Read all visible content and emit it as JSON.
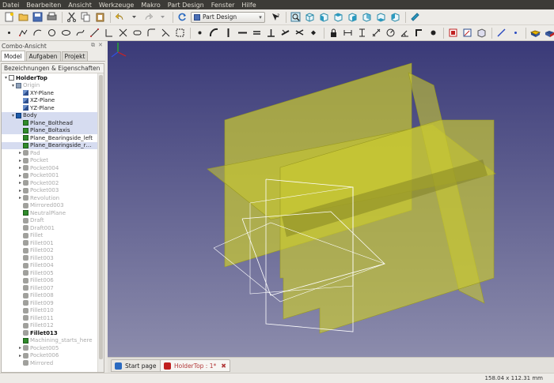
{
  "menubar": [
    "Datei",
    "Bearbeiten",
    "Ansicht",
    "Werkzeuge",
    "Makro",
    "Part Design",
    "Fenster",
    "Hilfe"
  ],
  "workbench": {
    "selected": "Part Design"
  },
  "combo": {
    "title": "Combo-Ansicht",
    "tabs": [
      "Model",
      "Aufgaben",
      "Projekt"
    ],
    "active_tab": "Model",
    "tree_header": "Bezeichnungen & Eigenschaften"
  },
  "tree": [
    {
      "label": "HolderTop",
      "depth": 0,
      "icon": "document-icon",
      "arrow": "expanded",
      "style": "bold"
    },
    {
      "label": "Origin",
      "depth": 1,
      "icon": "origin-folder-icon",
      "arrow": "expanded",
      "style": "faded"
    },
    {
      "label": "XY-Plane",
      "depth": 2,
      "icon": "plane-icon",
      "arrow": "",
      "style": ""
    },
    {
      "label": "XZ-Plane",
      "depth": 2,
      "icon": "plane-icon",
      "arrow": "",
      "style": ""
    },
    {
      "label": "YZ-Plane",
      "depth": 2,
      "icon": "plane-icon",
      "arrow": "",
      "style": ""
    },
    {
      "label": "Body",
      "depth": 1,
      "icon": "body-icon",
      "arrow": "expanded",
      "style": "selected"
    },
    {
      "label": "Plane_Bolthead",
      "depth": 2,
      "icon": "datum-plane-icon",
      "arrow": "",
      "style": "selected"
    },
    {
      "label": "Plane_Boltaxis",
      "depth": 2,
      "icon": "datum-plane-icon",
      "arrow": "",
      "style": "selected"
    },
    {
      "label": "Plane_Bearingside_left",
      "depth": 2,
      "icon": "datum-plane-icon",
      "arrow": "",
      "style": ""
    },
    {
      "label": "Plane_Bearingside_r…",
      "depth": 2,
      "icon": "datum-plane-icon",
      "arrow": "",
      "style": "selected"
    },
    {
      "label": "Pad",
      "depth": 2,
      "icon": "pad-icon",
      "arrow": "collapsed",
      "style": "faded"
    },
    {
      "label": "Pocket",
      "depth": 2,
      "icon": "pocket-icon",
      "arrow": "collapsed",
      "style": "faded"
    },
    {
      "label": "Pocket004",
      "depth": 2,
      "icon": "pocket-icon",
      "arrow": "collapsed",
      "style": "faded"
    },
    {
      "label": "Pocket001",
      "depth": 2,
      "icon": "pocket-icon",
      "arrow": "collapsed",
      "style": "faded"
    },
    {
      "label": "Pocket002",
      "depth": 2,
      "icon": "pocket-icon",
      "arrow": "collapsed",
      "style": "faded"
    },
    {
      "label": "Pocket003",
      "depth": 2,
      "icon": "pocket-icon",
      "arrow": "collapsed",
      "style": "faded"
    },
    {
      "label": "Revolution",
      "depth": 2,
      "icon": "revolution-icon",
      "arrow": "collapsed",
      "style": "faded"
    },
    {
      "label": "Mirrored003",
      "depth": 2,
      "icon": "mirrored-icon",
      "arrow": "",
      "style": "faded"
    },
    {
      "label": "NeutralPlane",
      "depth": 2,
      "icon": "datum-plane-icon",
      "arrow": "",
      "style": "faded"
    },
    {
      "label": "Draft",
      "depth": 2,
      "icon": "draft-icon",
      "arrow": "",
      "style": "faded"
    },
    {
      "label": "Draft001",
      "depth": 2,
      "icon": "draft-icon",
      "arrow": "",
      "style": "faded"
    },
    {
      "label": "Fillet",
      "depth": 2,
      "icon": "fillet-icon",
      "arrow": "",
      "style": "faded"
    },
    {
      "label": "Fillet001",
      "depth": 2,
      "icon": "fillet-icon",
      "arrow": "",
      "style": "faded"
    },
    {
      "label": "Fillet002",
      "depth": 2,
      "icon": "fillet-icon",
      "arrow": "",
      "style": "faded"
    },
    {
      "label": "Fillet003",
      "depth": 2,
      "icon": "fillet-icon",
      "arrow": "",
      "style": "faded"
    },
    {
      "label": "Fillet004",
      "depth": 2,
      "icon": "fillet-icon",
      "arrow": "",
      "style": "faded"
    },
    {
      "label": "Fillet005",
      "depth": 2,
      "icon": "fillet-icon",
      "arrow": "",
      "style": "faded"
    },
    {
      "label": "Fillet006",
      "depth": 2,
      "icon": "fillet-icon",
      "arrow": "",
      "style": "faded"
    },
    {
      "label": "Fillet007",
      "depth": 2,
      "icon": "fillet-icon",
      "arrow": "",
      "style": "faded"
    },
    {
      "label": "Fillet008",
      "depth": 2,
      "icon": "fillet-icon",
      "arrow": "",
      "style": "faded"
    },
    {
      "label": "Fillet009",
      "depth": 2,
      "icon": "fillet-icon",
      "arrow": "",
      "style": "faded"
    },
    {
      "label": "Fillet010",
      "depth": 2,
      "icon": "fillet-icon",
      "arrow": "",
      "style": "faded"
    },
    {
      "label": "Fillet011",
      "depth": 2,
      "icon": "fillet-icon",
      "arrow": "",
      "style": "faded"
    },
    {
      "label": "Fillet012",
      "depth": 2,
      "icon": "fillet-icon",
      "arrow": "",
      "style": "faded"
    },
    {
      "label": "Fillet013",
      "depth": 2,
      "icon": "fillet-icon",
      "arrow": "",
      "style": "bold"
    },
    {
      "label": "Machining_starts_here",
      "depth": 2,
      "icon": "datum-plane-icon",
      "arrow": "",
      "style": "faded"
    },
    {
      "label": "Pocket005",
      "depth": 2,
      "icon": "pocket-icon",
      "arrow": "collapsed",
      "style": "faded"
    },
    {
      "label": "Pocket006",
      "depth": 2,
      "icon": "pocket-icon",
      "arrow": "collapsed",
      "style": "faded"
    },
    {
      "label": "Mirrored",
      "depth": 2,
      "icon": "mirrored-icon",
      "arrow": "",
      "style": "faded"
    }
  ],
  "doc_tabs": [
    {
      "label": "Start page",
      "icon": "freecad-start-icon",
      "active": false
    },
    {
      "label": "HolderTop : 1*",
      "icon": "part-document-icon",
      "active": true
    }
  ],
  "status": {
    "dimensions": "158.04 x 112.31 mm"
  },
  "colors": {
    "viewport_top": "#3a3a78",
    "viewport_bottom": "#8c8cac",
    "plane_fill": "#c8c832",
    "selection": "#d6dcf0",
    "menubar_bg": "#3c3b37"
  }
}
